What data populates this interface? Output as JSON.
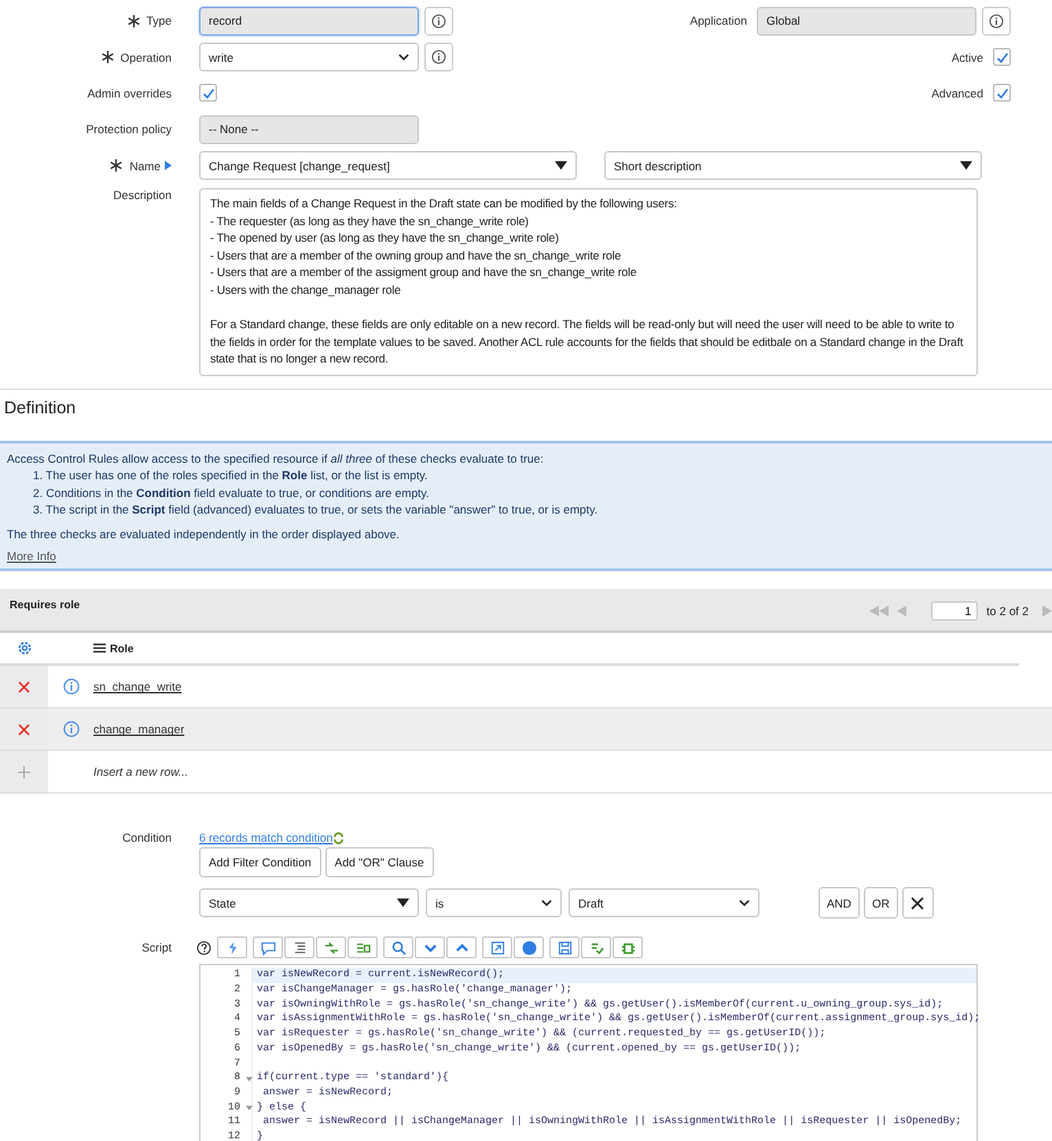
{
  "fields": {
    "type": {
      "label": "Type",
      "required": true,
      "value": "record"
    },
    "application": {
      "label": "Application",
      "value": "Global"
    },
    "operation": {
      "label": "Operation",
      "required": true,
      "value": "write"
    },
    "active": {
      "label": "Active",
      "checked": true
    },
    "admin_overrides": {
      "label": "Admin overrides",
      "checked": true
    },
    "advanced": {
      "label": "Advanced",
      "checked": true
    },
    "protection_policy": {
      "label": "Protection policy",
      "value": "-- None --"
    },
    "name": {
      "label": "Name",
      "required": true,
      "table": "Change Request [change_request]",
      "field": "Short description"
    },
    "description": {
      "label": "Description",
      "value": "The main fields of a Change Request in the Draft state can be modified by the following users:\n- The requester (as long as they have the sn_change_write role)\n- The opened by user (as long as they have the sn_change_write role)\n- Users that are a member of the owning group and have the sn_change_write role\n- Users that are a member of the assigment group and have the sn_change_write role\n- Users with the change_manager role\n\nFor a Standard change, these fields are only editable on a new record. The fields will be read-only but will need the user will need to be able to write to the fields in order for the template values to be saved. Another ACL rule accounts for the fields that should be editbale on a Standard change in the Draft state that is no longer a new record."
    }
  },
  "definition": {
    "heading": "Definition",
    "intro": "Access Control Rules allow access to the specified resource if *all three* of these checks evaluate to true:",
    "checks": [
      "1. The user has one of the roles specified in the **Role** list, or the list is empty.",
      "2. Conditions in the **Condition** field evaluate to true, or conditions are empty.",
      "3. The script in the **Script** field (advanced) evaluates to true, or sets the variable \"answer\" to true, or is empty."
    ],
    "note": "The three checks are evaluated independently in the order displayed above.",
    "link": "More Info"
  },
  "roles": {
    "title": "Requires role",
    "page": "1",
    "total": "to 2 of 2",
    "column": "Role",
    "rows": [
      {
        "name": "sn_change_write"
      },
      {
        "name": "change_manager"
      }
    ],
    "insert": "Insert a new row..."
  },
  "condition": {
    "label": "Condition",
    "match": "6 records match condition",
    "buttons": [
      "Add Filter Condition",
      "Add \"OR\" Clause"
    ],
    "field": "State",
    "operator": "is",
    "value": "Draft",
    "actions": [
      "AND",
      "OR"
    ]
  },
  "script": {
    "label": "Script",
    "lines": [
      {
        "number": "1",
        "text": "var isNewRecord = current.isNewRecord();",
        "active": true,
        "foldable": false
      },
      {
        "number": "2",
        "text": "var isChangeManager = gs.hasRole('change_manager');",
        "active": false,
        "foldable": false
      },
      {
        "number": "3",
        "text": "var isOwningWithRole = gs.hasRole('sn_change_write') && gs.getUser().isMemberOf(current.u_owning_group.sys_id);",
        "active": false,
        "foldable": false
      },
      {
        "number": "4",
        "text": "var isAssignmentWithRole = gs.hasRole('sn_change_write') && gs.getUser().isMemberOf(current.assignment_group.sys_id);",
        "active": false,
        "foldable": false
      },
      {
        "number": "5",
        "text": "var isRequester = gs.hasRole('sn_change_write') && (current.requested_by == gs.getUserID());",
        "active": false,
        "foldable": false
      },
      {
        "number": "6",
        "text": "var isOpenedBy = gs.hasRole('sn_change_write') && (current.opened_by == gs.getUserID());",
        "active": false,
        "foldable": false
      },
      {
        "number": "7",
        "active": false,
        "foldable": false
      },
      {
        "number": "8",
        "text": "if(current.type == 'standard'){",
        "active": false,
        "foldable": true
      },
      {
        "number": "9",
        "text": " answer = isNewRecord;",
        "active": false,
        "foldable": false
      },
      {
        "number": "10",
        "text": "} else {",
        "active": false,
        "foldable": true
      },
      {
        "number": "11",
        "text": " answer = isNewRecord || isChangeManager || isOwningWithRole || isAssignmentWithRole || isRequester || isOpenedBy;",
        "active": false,
        "foldable": false
      },
      {
        "number": "12",
        "text": "}",
        "active": false,
        "foldable": false
      }
    ]
  }
}
